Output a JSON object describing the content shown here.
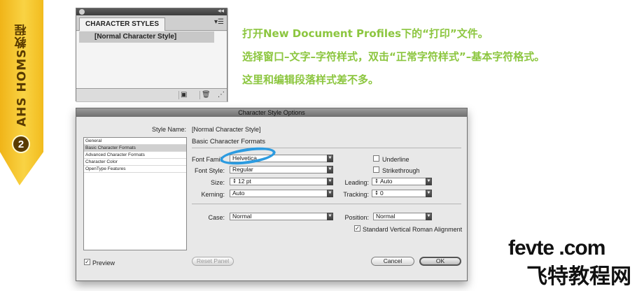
{
  "side_tab": {
    "text": "AHS HOMS教程",
    "step": "2"
  },
  "char_styles_panel": {
    "tab_label": "CHARACTER STYLES",
    "items": [
      "[Normal Character Style]"
    ],
    "collapse_icon": "double-chevron-icon",
    "menu_icon": "panel-menu-icon"
  },
  "instructions": [
    "打开New Document Profiles下的“打印”文件。",
    "选择窗口–文字–字符样式，双击“正常字符样式”–基本字符格式。",
    "这里和编辑段落样式差不多。"
  ],
  "dialog": {
    "title": "Character Style Options",
    "style_name_label": "Style Name:",
    "style_name_value": "[Normal Character Style]",
    "nav_items": [
      "General",
      "Basic Character Formats",
      "Advanced Character Formats",
      "Character Color",
      "OpenType Features"
    ],
    "selected_nav": "Basic Character Formats",
    "section_title": "Basic Character Formats",
    "font_family_label": "Font Famil",
    "font_family_value": "Helvetica",
    "font_style_label": "Font Style:",
    "font_style_value": "Regular",
    "size_label": "Size:",
    "size_value": "12 pt",
    "kerning_label": "Kerning:",
    "kerning_value": "Auto",
    "leading_label": "Leading:",
    "leading_value": "Auto",
    "tracking_label": "Tracking:",
    "tracking_value": "0",
    "underline_label": "Underline",
    "underline_checked": false,
    "strikethrough_label": "Strikethrough",
    "strikethrough_checked": false,
    "case_label": "Case:",
    "case_value": "Normal",
    "position_label": "Position:",
    "position_value": "Normal",
    "svra_label": "Standard Vertical Roman Alignment",
    "svra_checked": true,
    "preview_label": "Preview",
    "preview_checked": true,
    "reset_label": "Reset Panel",
    "cancel_label": "Cancel",
    "ok_label": "OK"
  },
  "watermark": {
    "line1": "fevte .com",
    "line2": "飞特教程网"
  },
  "colors": {
    "instruction_green": "#8cc63f",
    "tab_yellow": "#f9d344",
    "highlight_blue": "#2c9be0"
  }
}
